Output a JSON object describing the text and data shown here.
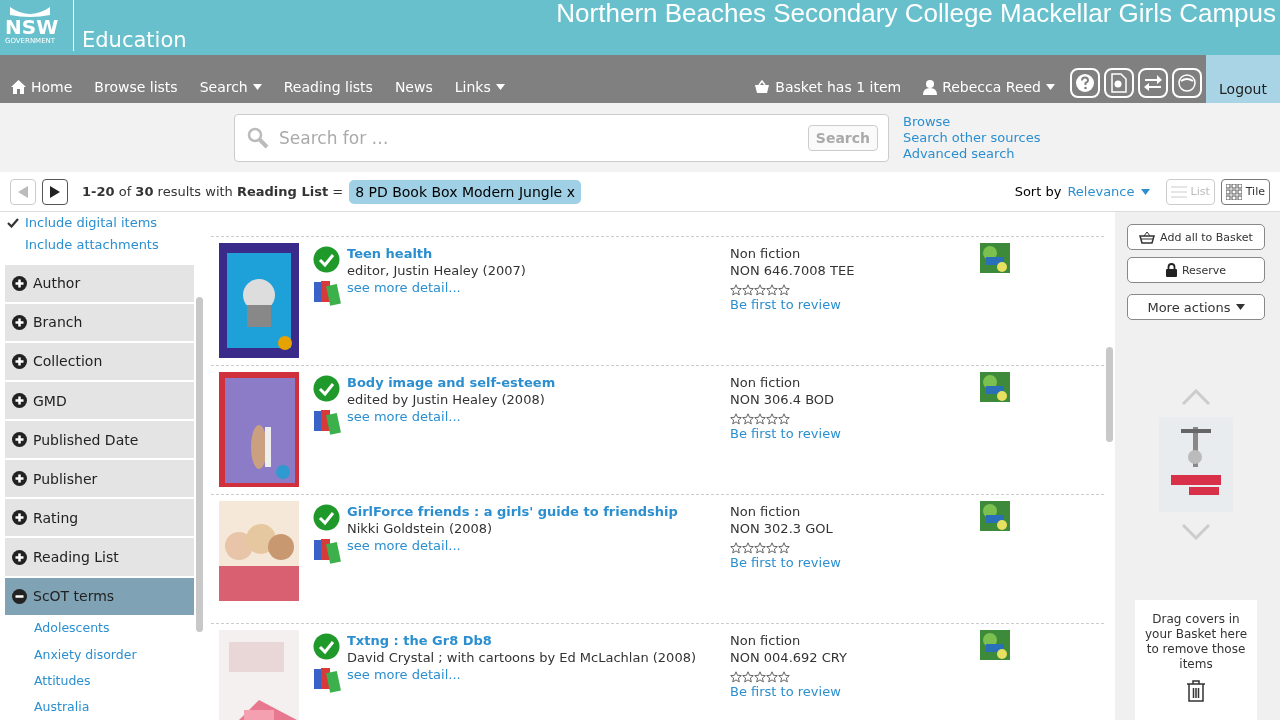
{
  "header": {
    "logo": "NSW",
    "logo_sub": "GOVERNMENT",
    "department": "Education",
    "title": "Northern Beaches Secondary College Mackellar Girls Campus"
  },
  "nav": {
    "items": [
      {
        "label": "Home",
        "kind": "home"
      },
      {
        "label": "Browse lists",
        "kind": "link"
      },
      {
        "label": "Search",
        "kind": "menu"
      },
      {
        "label": "Reading lists",
        "kind": "link"
      },
      {
        "label": "News",
        "kind": "link"
      },
      {
        "label": "Links",
        "kind": "menu"
      }
    ],
    "basket": "Basket has 1 item",
    "user": "Rebecca Reed",
    "logout": "Logout"
  },
  "search": {
    "placeholder": "Search for …",
    "button": "Search",
    "links": [
      "Browse",
      "Search other sources",
      "Advanced search"
    ]
  },
  "results_bar": {
    "summary": "**1-20** of **30** results with **Reading List** =",
    "filter": "8 PD Book Box Modern Jungle",
    "remove": "x",
    "sort_label": "Sort by",
    "sort_value": "Relevance",
    "views": [
      {
        "label": "List",
        "selected": false
      },
      {
        "label": "Tile",
        "selected": true
      }
    ]
  },
  "sidebar": {
    "options": [
      {
        "label": "Include digital items",
        "checked": true
      },
      {
        "label": "Include attachments",
        "checked": false
      }
    ],
    "facets": [
      {
        "label": "Author",
        "expanded": false
      },
      {
        "label": "Branch",
        "expanded": false
      },
      {
        "label": "Collection",
        "expanded": false
      },
      {
        "label": "GMD",
        "expanded": false
      },
      {
        "label": "Published Date",
        "expanded": false
      },
      {
        "label": "Publisher",
        "expanded": false
      },
      {
        "label": "Rating",
        "expanded": false
      },
      {
        "label": "Reading List",
        "expanded": false
      },
      {
        "label": "ScOT terms",
        "expanded": true,
        "terms": [
          "Adolescents",
          "Anxiety disorder",
          "Attitudes",
          "Australia"
        ]
      }
    ]
  },
  "results": [
    {
      "title": "Teen health",
      "author": "editor, Justin Healey (2007)",
      "detail": "see more detail...",
      "available": true,
      "format": "Non fiction",
      "call_number": "NON 646.7008 TEE",
      "stars": 0,
      "review": "Be first to review"
    },
    {
      "title": "Body image and self-esteem",
      "author": "edited by Justin Healey (2008)",
      "detail": "see more detail...",
      "available": true,
      "format": "Non fiction",
      "call_number": "NON 306.4 BOD",
      "stars": 0,
      "review": "Be first to review"
    },
    {
      "title": "GirlForce friends : a girls' guide to friendship",
      "author": "Nikki Goldstein (2008)",
      "detail": "see more detail...",
      "available": true,
      "format": "Non fiction",
      "call_number": "NON 302.3 GOL",
      "stars": 0,
      "review": "Be first to review"
    },
    {
      "title": "Txtng : the Gr8 Db8",
      "author": "David Crystal ; with cartoons by Ed McLachlan (2008)",
      "detail": "see more detail...",
      "available": true,
      "format": "Non fiction",
      "call_number": "NON 004.692 CRY",
      "stars": 0,
      "review": "Be first to review"
    }
  ],
  "actions": {
    "buttons": [
      {
        "label": "Add all to Basket",
        "kind": "basket"
      },
      {
        "label": "Reserve",
        "kind": "lock"
      },
      {
        "label": "More actions",
        "kind": "menu"
      }
    ],
    "drop_hint": "Drag covers in your Basket here to remove those items"
  }
}
